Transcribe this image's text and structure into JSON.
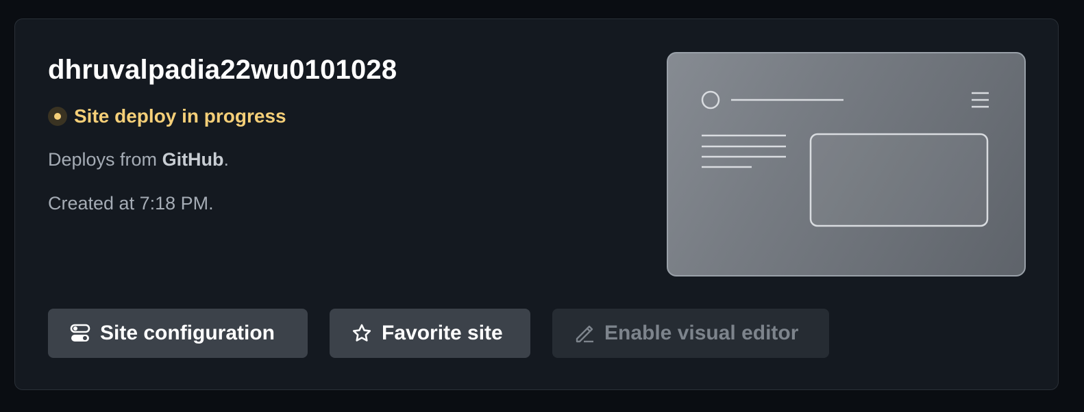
{
  "site": {
    "name": "dhruvalpadia22wu0101028",
    "status_text": "Site deploy in progress",
    "status_color": "#f5cf78",
    "deploy_prefix": "Deploys from ",
    "deploy_source": "GitHub",
    "deploy_suffix": ".",
    "created_text": "Created at 7:18 PM."
  },
  "actions": {
    "config_label": "Site configuration",
    "config_icon": "toggles-icon",
    "favorite_label": "Favorite site",
    "favorite_icon": "star-icon",
    "editor_label": "Enable visual editor",
    "editor_icon": "pencil-icon",
    "editor_disabled": true
  },
  "colors": {
    "background": "#0a0d12",
    "card": "#141920",
    "button": "#3c424a",
    "button_disabled": "#262c33",
    "accent_status": "#f5cf78"
  }
}
